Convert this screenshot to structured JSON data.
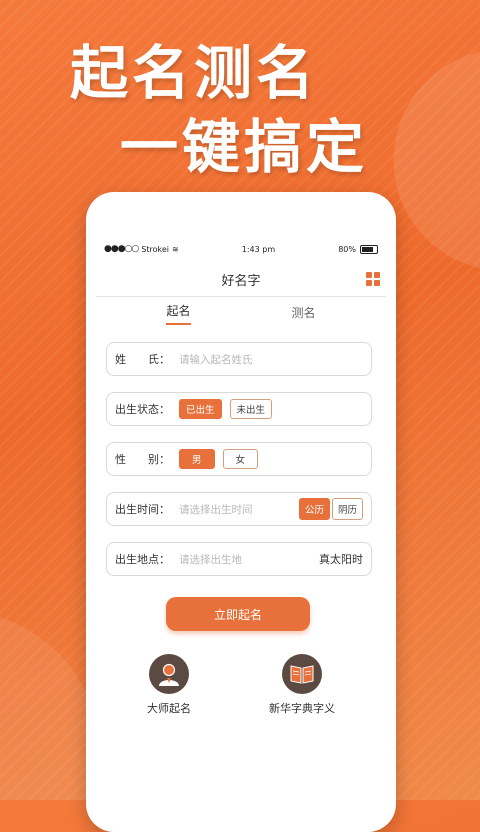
{
  "hero": {
    "line1": "起名测名",
    "line2": "一键搞定"
  },
  "status_bar": {
    "carrier": "Strokei",
    "time": "1:43 pm",
    "battery": "80%"
  },
  "topbar": {
    "title": "好名字"
  },
  "tabs": [
    {
      "label": "起名",
      "active": true
    },
    {
      "label": "测名",
      "active": false
    }
  ],
  "form": {
    "surname": {
      "label": "姓　　氏：",
      "placeholder": "请输入起名姓氏"
    },
    "birth_status": {
      "label": "出生状态：",
      "options": [
        "已出生",
        "未出生"
      ],
      "selected": "已出生"
    },
    "gender": {
      "label": "性　　别：",
      "options": [
        "男",
        "女"
      ],
      "selected": "男"
    },
    "birth_time": {
      "label": "出生时间：",
      "placeholder": "请选择出生时间",
      "calendars": [
        "公历",
        "阴历"
      ],
      "selected": "公历"
    },
    "birth_place": {
      "label": "出生地点：",
      "placeholder": "请选择出生地",
      "solar_label": "真太阳时"
    }
  },
  "submit_label": "立即起名",
  "features": [
    {
      "label": "大师起名",
      "icon": "master-icon"
    },
    {
      "label": "新华字典字义",
      "icon": "dictionary-icon"
    }
  ],
  "colors": {
    "accent": "#e8703a",
    "icon_bg": "#5a4a42"
  }
}
